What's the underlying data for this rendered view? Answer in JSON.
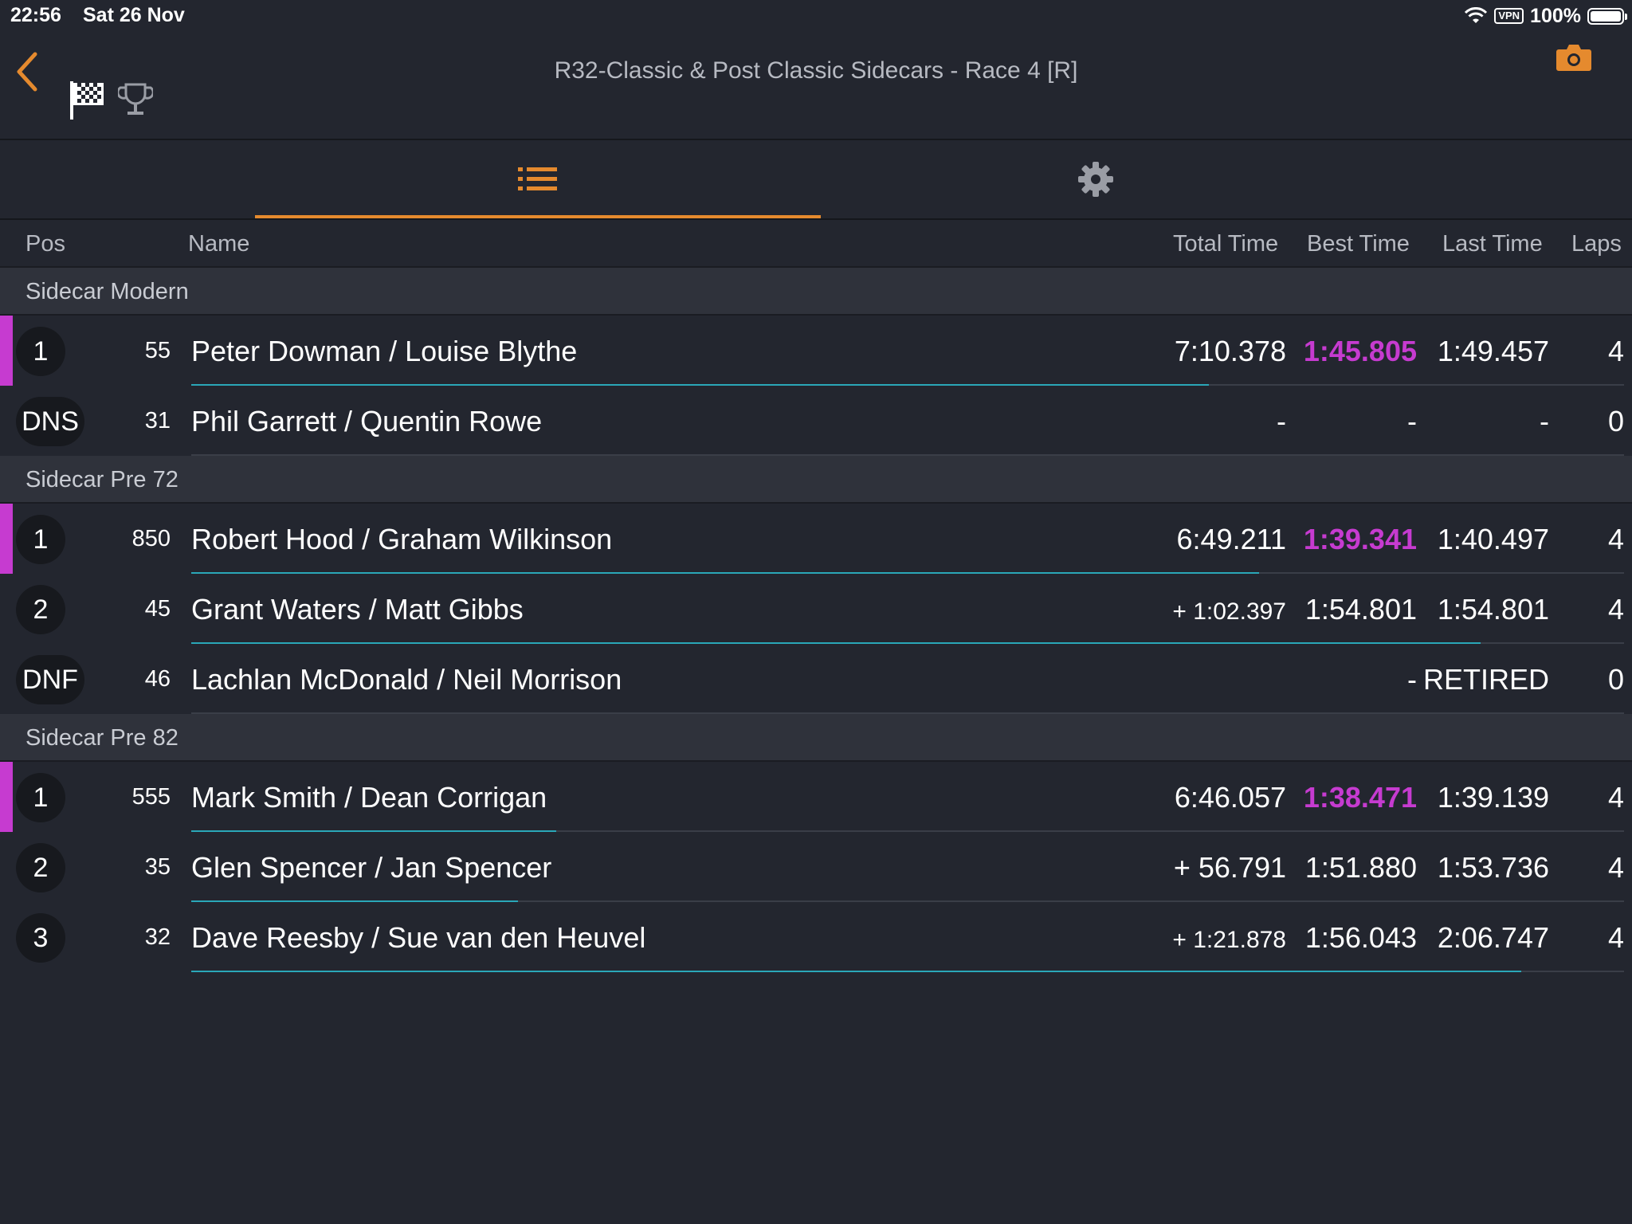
{
  "status_bar": {
    "time": "22:56",
    "date": "Sat 26 Nov",
    "vpn": "VPN",
    "battery": "100%"
  },
  "header": {
    "title": "R32-Classic & Post Classic Sidecars - Race 4 [R]"
  },
  "columns": {
    "pos": "Pos",
    "name": "Name",
    "total": "Total Time",
    "best": "Best Time",
    "last": "Last Time",
    "laps": "Laps"
  },
  "colors": {
    "accent": "#e58a2e",
    "fastest": "#c63bd0",
    "progress": "#2aa7b8"
  },
  "sections": [
    {
      "title": "Sidecar Modern",
      "rows": [
        {
          "pos": "1",
          "num": "55",
          "name": "Peter Dowman / Louise Blythe",
          "total": "7:10.378",
          "best": "1:45.805",
          "last": "1:49.457",
          "laps": "4",
          "leader": true,
          "fastest": true,
          "progress": 0.71
        },
        {
          "pos": "DNS",
          "num": "31",
          "name": "Phil Garrett / Quentin Rowe",
          "total": "-",
          "best": "-",
          "last": "-",
          "laps": "0",
          "leader": false,
          "fastest": false,
          "progress": 0
        }
      ]
    },
    {
      "title": "Sidecar Pre 72",
      "rows": [
        {
          "pos": "1",
          "num": "850",
          "name": "Robert Hood / Graham Wilkinson",
          "total": "6:49.211",
          "best": "1:39.341",
          "last": "1:40.497",
          "laps": "4",
          "leader": true,
          "fastest": true,
          "progress": 0.745
        },
        {
          "pos": "2",
          "num": "45",
          "name": "Grant Waters / Matt Gibbs",
          "total": "+ 1:02.397",
          "best": "1:54.801",
          "last": "1:54.801",
          "laps": "4",
          "leader": false,
          "fastest": false,
          "progress": 0.9
        },
        {
          "pos": "DNF",
          "num": "46",
          "name": "Lachlan McDonald / Neil Morrison",
          "total": "",
          "best": "-",
          "last": "RETIRED",
          "laps": "0",
          "leader": false,
          "fastest": false,
          "progress": 0
        }
      ]
    },
    {
      "title": "Sidecar Pre 82",
      "rows": [
        {
          "pos": "1",
          "num": "555",
          "name": "Mark Smith / Dean Corrigan",
          "total": "6:46.057",
          "best": "1:38.471",
          "last": "1:39.139",
          "laps": "4",
          "leader": true,
          "fastest": true,
          "progress": 0.255
        },
        {
          "pos": "2",
          "num": "35",
          "name": "Glen Spencer / Jan Spencer",
          "total": "+ 56.791",
          "best": "1:51.880",
          "last": "1:53.736",
          "laps": "4",
          "leader": false,
          "fastest": false,
          "progress": 0.228
        },
        {
          "pos": "3",
          "num": "32",
          "name": "Dave Reesby / Sue van den Heuvel",
          "total": "+ 1:21.878",
          "best": "1:56.043",
          "last": "2:06.747",
          "laps": "4",
          "leader": false,
          "fastest": false,
          "progress": 0.928
        }
      ]
    }
  ]
}
